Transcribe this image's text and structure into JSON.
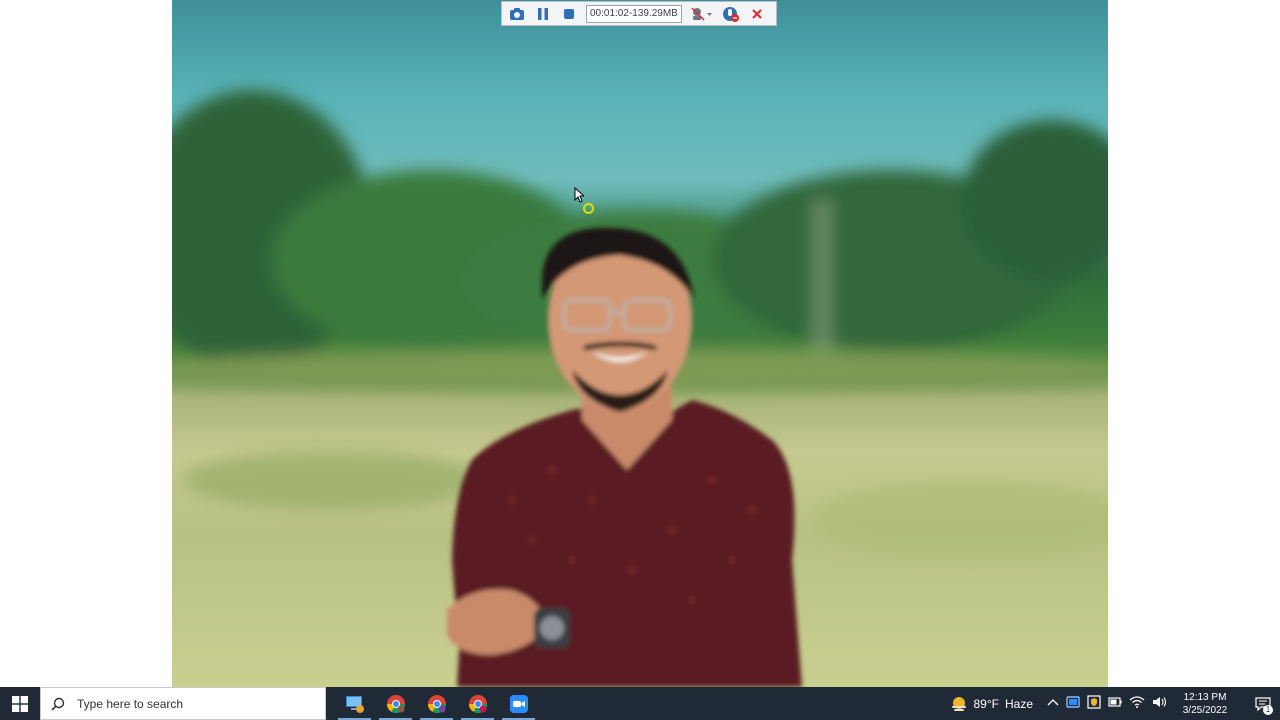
{
  "recorder": {
    "timer": "00:01:02-139.29MB",
    "icons": [
      "camera-icon",
      "pause-icon",
      "stop-icon",
      "webcam-icon",
      "microphone-icon",
      "close-icon"
    ],
    "close_color": "#e0262c"
  },
  "photo": {
    "subject": "portrait",
    "colors": {
      "sky": "#5ab3b8",
      "trees": "#2f6e3c",
      "field": "#c6c98f",
      "shirt": "#5a1b22"
    }
  },
  "taskbar": {
    "search_placeholder": "Type here to search",
    "apps": [
      {
        "icon": "this-pc-icon",
        "running": true
      },
      {
        "icon": "chrome-icon",
        "running": true
      },
      {
        "icon": "chrome-profile-icon",
        "running": true
      },
      {
        "icon": "chrome-profile-2-icon",
        "running": true
      },
      {
        "icon": "zoom-icon",
        "running": true
      }
    ],
    "weather": {
      "temp": "89°F",
      "condition": "Haze"
    },
    "tray_icons": [
      "chevron-up-icon",
      "meet-now-icon",
      "defender-icon",
      "battery-icon",
      "wifi-icon",
      "volume-icon"
    ],
    "clock": {
      "time": "12:13 PM",
      "date": "3/25/2022"
    },
    "notifications": "1",
    "background": "#1f2a36"
  }
}
